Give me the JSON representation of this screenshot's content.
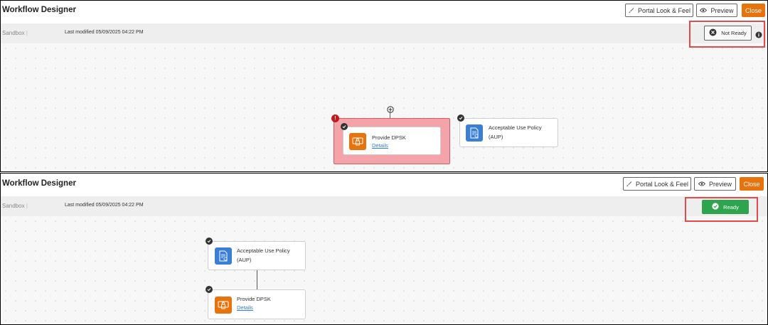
{
  "top": {
    "title": "Workflow Designer",
    "portal_label": "Portal Look & Feel",
    "preview_label": "Preview",
    "close_label": "Close",
    "sandbox": "Sandbox",
    "modified": "Last modified 05/09/2025 04:22 PM",
    "status": "Not Ready",
    "nodes": [
      {
        "title": "Provide DPSK",
        "link": "Details"
      },
      {
        "title_line1": "Acceptable Use Policy",
        "title_line2": "(AUP)"
      }
    ]
  },
  "bottom": {
    "title": "Workflow Designer",
    "portal_label": "Portal Look & Feel",
    "preview_label": "Preview",
    "close_label": "Close",
    "sandbox": "Sandbox",
    "modified": "Last modified 05/09/2025 04:22 PM",
    "status": "Ready",
    "nodes": [
      {
        "title_line1": "Acceptable Use Policy",
        "title_line2": "(AUP)"
      },
      {
        "title": "Provide DPSK",
        "link": "Details"
      }
    ]
  },
  "colors": {
    "accent_orange": "#e8730c",
    "icon_blue": "#3a7fd5",
    "ready_green": "#2ea44f",
    "error_pink": "#f4a3a8",
    "highlight_red": "#e04c4c"
  },
  "icons": [
    "brush-icon",
    "eye-icon",
    "x-circle-icon",
    "info-icon",
    "plus-circle-icon",
    "error-icon",
    "check-icon",
    "dpsk-icon",
    "document-icon"
  ]
}
